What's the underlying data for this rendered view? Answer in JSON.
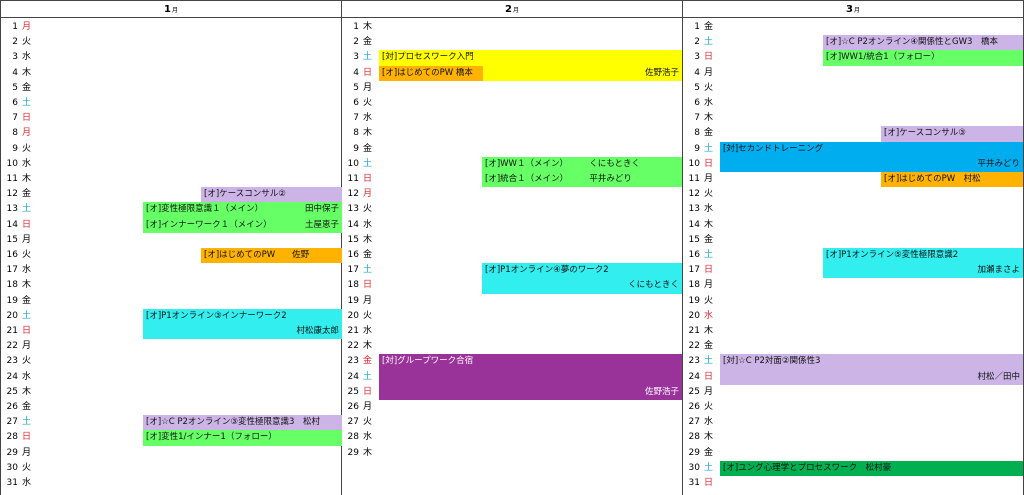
{
  "colors": {
    "lavender": "#cdb4e6",
    "green": "#66ff66",
    "gold": "#ffb300",
    "yellow": "#ffff00",
    "cyan": "#33eeee",
    "blue": "#00aeef",
    "purple": "#993399",
    "darkgreen": "#00b050",
    "saturday": "#1aa5cf",
    "sunday": "#e0242c"
  },
  "months": [
    {
      "label": "1",
      "suffix": "月",
      "days": [
        {
          "n": "1",
          "w": "月",
          "c": "sun"
        },
        {
          "n": "2",
          "w": "火",
          "c": ""
        },
        {
          "n": "3",
          "w": "水",
          "c": ""
        },
        {
          "n": "4",
          "w": "木",
          "c": ""
        },
        {
          "n": "5",
          "w": "金",
          "c": ""
        },
        {
          "n": "6",
          "w": "土",
          "c": "sat"
        },
        {
          "n": "7",
          "w": "日",
          "c": "sun"
        },
        {
          "n": "8",
          "w": "月",
          "c": "sun"
        },
        {
          "n": "9",
          "w": "火",
          "c": ""
        },
        {
          "n": "10",
          "w": "水",
          "c": ""
        },
        {
          "n": "11",
          "w": "木",
          "c": ""
        },
        {
          "n": "12",
          "w": "金",
          "c": ""
        },
        {
          "n": "13",
          "w": "土",
          "c": "sat"
        },
        {
          "n": "14",
          "w": "日",
          "c": "sun"
        },
        {
          "n": "15",
          "w": "月",
          "c": ""
        },
        {
          "n": "16",
          "w": "火",
          "c": ""
        },
        {
          "n": "17",
          "w": "水",
          "c": ""
        },
        {
          "n": "18",
          "w": "木",
          "c": ""
        },
        {
          "n": "19",
          "w": "金",
          "c": ""
        },
        {
          "n": "20",
          "w": "土",
          "c": "sat"
        },
        {
          "n": "21",
          "w": "日",
          "c": "sun"
        },
        {
          "n": "22",
          "w": "月",
          "c": ""
        },
        {
          "n": "23",
          "w": "火",
          "c": ""
        },
        {
          "n": "24",
          "w": "水",
          "c": ""
        },
        {
          "n": "25",
          "w": "木",
          "c": ""
        },
        {
          "n": "26",
          "w": "金",
          "c": ""
        },
        {
          "n": "27",
          "w": "土",
          "c": "sat"
        },
        {
          "n": "28",
          "w": "日",
          "c": "sun"
        },
        {
          "n": "29",
          "w": "月",
          "c": ""
        },
        {
          "n": "30",
          "w": "火",
          "c": ""
        },
        {
          "n": "31",
          "w": "水",
          "c": ""
        }
      ],
      "events": [
        {
          "row": 12,
          "rows": 1,
          "indent": 1,
          "color": "lavender",
          "title": "[オ]ケースコンサル②",
          "person": ""
        },
        {
          "row": 13,
          "rows": 1,
          "indent": 0,
          "color": "green",
          "title": "[オ]変性極限意識１（メイン）",
          "person": "田中保子"
        },
        {
          "row": 14,
          "rows": 1,
          "indent": 0,
          "color": "green",
          "title": "[オ]インナーワーク１（メイン）",
          "person": "土屋恵子"
        },
        {
          "row": 16,
          "rows": 1,
          "indent": 1,
          "color": "gold",
          "title": "[オ]はじめてのPW　　佐野",
          "person": ""
        },
        {
          "row": 20,
          "rows": 2,
          "indent": 0,
          "color": "cyan",
          "title": "[オ]P1オンライン③インナーワーク2",
          "person": "村松康太郎"
        },
        {
          "row": 27,
          "rows": 1,
          "indent": 0,
          "color": "lavender",
          "title": "[オ]☆C P2オンライン③変性極限意識3　松村",
          "person": ""
        },
        {
          "row": 28,
          "rows": 1,
          "indent": 0,
          "color": "green",
          "title": "[オ]変性1/インナー1（フォロー）",
          "person": ""
        }
      ]
    },
    {
      "label": "2",
      "suffix": "月",
      "days": [
        {
          "n": "1",
          "w": "木",
          "c": ""
        },
        {
          "n": "2",
          "w": "金",
          "c": ""
        },
        {
          "n": "3",
          "w": "土",
          "c": "sat"
        },
        {
          "n": "4",
          "w": "日",
          "c": "sun"
        },
        {
          "n": "5",
          "w": "月",
          "c": ""
        },
        {
          "n": "6",
          "w": "火",
          "c": ""
        },
        {
          "n": "7",
          "w": "水",
          "c": ""
        },
        {
          "n": "8",
          "w": "木",
          "c": ""
        },
        {
          "n": "9",
          "w": "金",
          "c": ""
        },
        {
          "n": "10",
          "w": "土",
          "c": "sat"
        },
        {
          "n": "11",
          "w": "日",
          "c": "sun"
        },
        {
          "n": "12",
          "w": "月",
          "c": "sun"
        },
        {
          "n": "13",
          "w": "火",
          "c": ""
        },
        {
          "n": "14",
          "w": "水",
          "c": ""
        },
        {
          "n": "15",
          "w": "木",
          "c": ""
        },
        {
          "n": "16",
          "w": "金",
          "c": ""
        },
        {
          "n": "17",
          "w": "土",
          "c": "sat"
        },
        {
          "n": "18",
          "w": "日",
          "c": "sun"
        },
        {
          "n": "19",
          "w": "月",
          "c": ""
        },
        {
          "n": "20",
          "w": "火",
          "c": ""
        },
        {
          "n": "21",
          "w": "水",
          "c": ""
        },
        {
          "n": "22",
          "w": "木",
          "c": ""
        },
        {
          "n": "23",
          "w": "金",
          "c": "sun"
        },
        {
          "n": "24",
          "w": "土",
          "c": "sat"
        },
        {
          "n": "25",
          "w": "日",
          "c": "sun"
        },
        {
          "n": "26",
          "w": "月",
          "c": ""
        },
        {
          "n": "27",
          "w": "火",
          "c": ""
        },
        {
          "n": "28",
          "w": "水",
          "c": ""
        },
        {
          "n": "29",
          "w": "木",
          "c": ""
        }
      ],
      "events": [
        {
          "row": 3,
          "rows": 1,
          "indent": 0,
          "color": "yellow",
          "title": "[対]プロセスワーク入門",
          "person": ""
        },
        {
          "row": 4,
          "rows": 1,
          "indent": 0,
          "color": "yellow",
          "title": "",
          "person": "佐野浩子"
        },
        {
          "row": 4,
          "rows": 1,
          "indent": 0,
          "width": "short",
          "color": "gold",
          "title": "[オ]はじめてのPW 橋本",
          "person": ""
        },
        {
          "row": 10,
          "rows": 1,
          "indent": 1,
          "color": "green",
          "title": "[オ]WW１（メイン）　　　くにもときく",
          "person": ""
        },
        {
          "row": 11,
          "rows": 1,
          "indent": 1,
          "color": "green",
          "title": "[オ]統合１（メイン）　　　平井みどり",
          "person": ""
        },
        {
          "row": 17,
          "rows": 2,
          "indent": 1,
          "color": "cyan",
          "title": "[オ]P1オンライン④夢のワーク2",
          "person": "くにもときく"
        },
        {
          "row": 23,
          "rows": 3,
          "indent": 0,
          "color": "purple",
          "title": "[対]グループワーク合宿",
          "person": "佐野浩子",
          "white": true
        }
      ]
    },
    {
      "label": "3",
      "suffix": "月",
      "days": [
        {
          "n": "1",
          "w": "金",
          "c": ""
        },
        {
          "n": "2",
          "w": "土",
          "c": "sat"
        },
        {
          "n": "3",
          "w": "日",
          "c": "sun"
        },
        {
          "n": "4",
          "w": "月",
          "c": ""
        },
        {
          "n": "5",
          "w": "火",
          "c": ""
        },
        {
          "n": "6",
          "w": "水",
          "c": ""
        },
        {
          "n": "7",
          "w": "木",
          "c": ""
        },
        {
          "n": "8",
          "w": "金",
          "c": ""
        },
        {
          "n": "9",
          "w": "土",
          "c": "sat"
        },
        {
          "n": "10",
          "w": "日",
          "c": "sun"
        },
        {
          "n": "11",
          "w": "月",
          "c": ""
        },
        {
          "n": "12",
          "w": "火",
          "c": ""
        },
        {
          "n": "13",
          "w": "水",
          "c": ""
        },
        {
          "n": "14",
          "w": "木",
          "c": ""
        },
        {
          "n": "15",
          "w": "金",
          "c": ""
        },
        {
          "n": "16",
          "w": "土",
          "c": "sat"
        },
        {
          "n": "17",
          "w": "日",
          "c": "sun"
        },
        {
          "n": "18",
          "w": "月",
          "c": ""
        },
        {
          "n": "19",
          "w": "火",
          "c": ""
        },
        {
          "n": "20",
          "w": "水",
          "c": "sun"
        },
        {
          "n": "21",
          "w": "木",
          "c": ""
        },
        {
          "n": "22",
          "w": "金",
          "c": ""
        },
        {
          "n": "23",
          "w": "土",
          "c": "sat"
        },
        {
          "n": "24",
          "w": "日",
          "c": "sun"
        },
        {
          "n": "25",
          "w": "月",
          "c": ""
        },
        {
          "n": "26",
          "w": "火",
          "c": ""
        },
        {
          "n": "27",
          "w": "水",
          "c": ""
        },
        {
          "n": "28",
          "w": "木",
          "c": ""
        },
        {
          "n": "29",
          "w": "金",
          "c": ""
        },
        {
          "n": "30",
          "w": "土",
          "c": "sat"
        },
        {
          "n": "31",
          "w": "日",
          "c": "sun"
        }
      ],
      "events": [
        {
          "row": 2,
          "rows": 1,
          "indent": 1,
          "color": "lavender",
          "title": "[オ]☆C P2オンライン④関係性とGW3　橋本",
          "person": ""
        },
        {
          "row": 3,
          "rows": 1,
          "indent": 1,
          "color": "green",
          "title": "[オ]WW1/統合1（フォロー）",
          "person": ""
        },
        {
          "row": 8,
          "rows": 1,
          "indent": 2,
          "color": "lavender",
          "title": "[オ]ケースコンサル③",
          "person": ""
        },
        {
          "row": 9,
          "rows": 2,
          "indent": 0,
          "color": "blue",
          "title": "[対]セカンドトレーニング",
          "person": "平井みどり"
        },
        {
          "row": 11,
          "rows": 1,
          "indent": 2,
          "color": "gold",
          "title": "[オ]はじめてのPW　村松",
          "person": ""
        },
        {
          "row": 16,
          "rows": 2,
          "indent": 1,
          "color": "cyan",
          "title": "[オ]P1オンライン⑤変性極限意識2",
          "person": "加瀬まさよ"
        },
        {
          "row": 23,
          "rows": 2,
          "indent": 0,
          "color": "lavender",
          "title": "[対]☆C P2対面②関係性3",
          "person": "村松／田中"
        },
        {
          "row": 30,
          "rows": 1,
          "indent": 0,
          "color": "darkgreen",
          "title": "[オ]ユング心理学とプロセスワーク　松村豪",
          "person": ""
        }
      ]
    }
  ]
}
